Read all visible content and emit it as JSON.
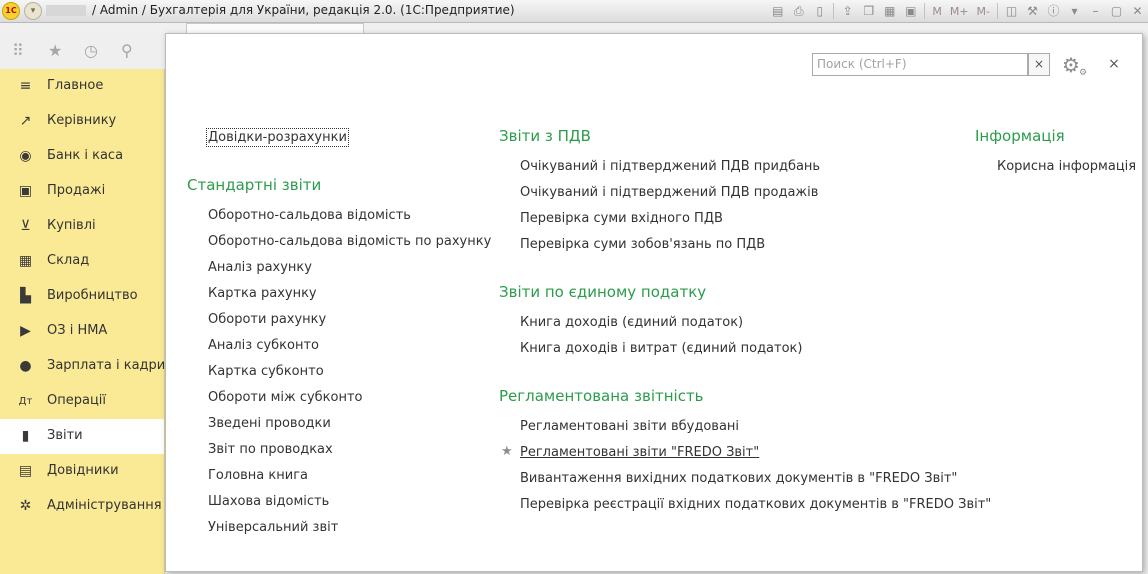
{
  "window": {
    "title": "/ Admin / Бухгалтерія для України, редакція 2.0.  (1С:Предприятие)",
    "logo_text": "1С",
    "menu_icon": "chevron-down-icon",
    "toolbar_icons": [
      "save-icon",
      "print-icon",
      "preview-icon",
      "upload-icon",
      "copy-icon",
      "calculator-icon",
      "calendar-icon",
      "compare-icon"
    ],
    "memory_buttons": [
      "M",
      "M+",
      "M-"
    ]
  },
  "sidebar": {
    "items": [
      {
        "label": "Главное",
        "icon": "menu-lines-icon",
        "glyph": "≡",
        "active": false
      },
      {
        "label": "Керівнику",
        "icon": "trend-icon",
        "glyph": "↗",
        "active": false
      },
      {
        "label": "Банк і каса",
        "icon": "money-icon",
        "glyph": "◉",
        "active": false
      },
      {
        "label": "Продажі",
        "icon": "bag-icon",
        "glyph": "▣",
        "active": false
      },
      {
        "label": "Купівлі",
        "icon": "cart-icon",
        "glyph": "⊻",
        "active": false
      },
      {
        "label": "Склад",
        "icon": "warehouse-icon",
        "glyph": "▦",
        "active": false
      },
      {
        "label": "Виробництво",
        "icon": "factory-icon",
        "glyph": "▙",
        "active": false
      },
      {
        "label": "ОЗ і НМА",
        "icon": "truck-icon",
        "glyph": "▶",
        "active": false
      },
      {
        "label": "Зарплата і кадри",
        "icon": "person-icon",
        "glyph": "●",
        "active": false
      },
      {
        "label": "Операції",
        "icon": "dt-kt-icon",
        "glyph": "Дт",
        "active": false
      },
      {
        "label": "Звіти",
        "icon": "bar-chart-icon",
        "glyph": "▮",
        "active": true
      },
      {
        "label": "Довідники",
        "icon": "book-icon",
        "glyph": "▤",
        "active": false
      },
      {
        "label": "Адміністрування",
        "icon": "gear-icon",
        "glyph": "✲",
        "active": false
      }
    ]
  },
  "panel": {
    "search_placeholder": "Поиск (Ctrl+F)",
    "clear_glyph": "×",
    "close_glyph": "×",
    "col1": {
      "top_link": "Довідки-розрахунки",
      "header": "Стандартні звіти",
      "items": [
        "Оборотно-сальдова відомість",
        "Оборотно-сальдова відомість по рахунку",
        "Аналіз рахунку",
        "Картка рахунку",
        "Обороти рахунку",
        "Аналіз субконто",
        "Картка субконто",
        "Обороти між субконто",
        "Зведені проводки",
        "Звіт по проводках",
        "Головна книга",
        "Шахова відомість",
        "Універсальний звіт"
      ]
    },
    "col2": {
      "vat_header": "Звіти з ПДВ",
      "vat_items": [
        "Очікуваний і підтверджений ПДВ придбань",
        "Очікуваний і підтверджений ПДВ продажів",
        "Перевірка суми вхідного ПДВ",
        "Перевірка суми зобов'язань по ПДВ"
      ],
      "single_tax_header": "Звіти по єдиному податку",
      "single_tax_items": [
        "Книга доходів (єдиний податок)",
        "Книга доходів і витрат (єдиний податок)"
      ],
      "reg_header": "Регламентована звітність",
      "reg_items": [
        "Регламентовані звіти вбудовані",
        "Регламентовані звіти \"FREDO Звіт\"",
        "Вивантаження вихідних податкових документів в \"FREDO Звіт\"",
        "Перевірка реєстрації вхідних податкових документів в \"FREDO Звіт\""
      ]
    },
    "col3": {
      "header": "Інформація",
      "items": [
        "Корисна інформація"
      ]
    }
  }
}
